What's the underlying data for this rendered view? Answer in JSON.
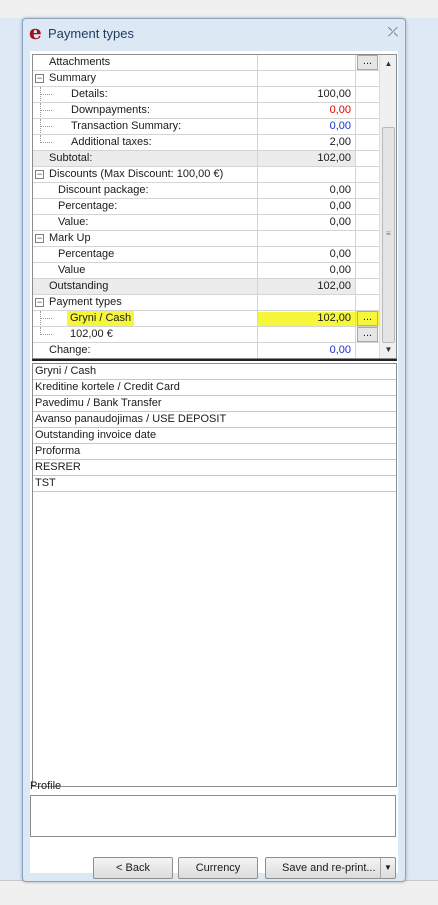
{
  "window": {
    "title": "Payment types",
    "app_icon": "e",
    "close_glyph": "⤫"
  },
  "summary": {
    "attachments": {
      "label": "Attachments",
      "btn": "..."
    },
    "summary": {
      "label": "Summary"
    },
    "details": {
      "label": "Details:",
      "value": "100,00"
    },
    "downpayments": {
      "label": "Downpayments:",
      "value": "0,00",
      "color": "#e00000"
    },
    "transaction_summary": {
      "label": "Transaction Summary:",
      "value": "0,00",
      "color": "#1a2fcf"
    },
    "additional_taxes": {
      "label": "Additional taxes:",
      "value": "2,00"
    },
    "subtotal": {
      "label": "Subtotal:",
      "value": "102,00"
    },
    "discounts": {
      "label": "Discounts (Max Discount: 100,00 €)"
    },
    "discount_package": {
      "label": "Discount package:",
      "value": "0,00"
    },
    "percentage": {
      "label": "Percentage:",
      "value": "0,00"
    },
    "value": {
      "label": "Value:",
      "value": "0,00"
    },
    "markup": {
      "label": "Mark Up"
    },
    "markup_percentage": {
      "label": "Percentage",
      "value": "0,00"
    },
    "markup_value": {
      "label": "Value",
      "value": "0,00"
    },
    "outstanding": {
      "label": "Outstanding",
      "value": "102,00"
    },
    "payment_types": {
      "label": "Payment types"
    },
    "cash": {
      "label": "Gryni / Cash",
      "value": "102,00",
      "btn": "..."
    },
    "amount": {
      "label": "102,00 €",
      "btn": "..."
    },
    "change": {
      "label": "Change:",
      "value": "0,00",
      "color": "#1a2fcf"
    },
    "expand_glyph": "−",
    "highlight_color": "#f6f63a"
  },
  "payment_list": [
    "Gryni / Cash",
    "Kreditine kortele / Credit Card",
    "Pavedimu / Bank Transfer",
    "Avanso panaudojimas / USE DEPOSIT",
    "Outstanding invoice date",
    "Proforma",
    "RESRER",
    "TST"
  ],
  "profile": {
    "label": "Profile"
  },
  "buttons": {
    "back": "< Back",
    "currency": "Currency",
    "save_reprint": "Save and re-print...",
    "dropdown_glyph": "▼"
  },
  "scrollbar": {
    "up": "▲",
    "down": "▼",
    "grip": "≡"
  }
}
